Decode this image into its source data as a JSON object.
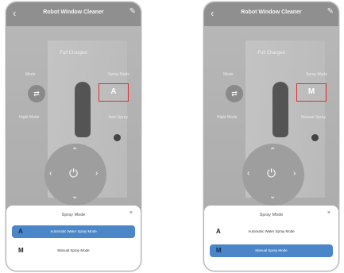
{
  "header": {
    "back_icon": "chevron-left-icon",
    "title": "Robot Window Cleaner",
    "edit_icon": "edit-icon"
  },
  "status": "Full Charged",
  "controls": {
    "mode_label": "Mode",
    "spray_mode_label": "Spray Mode",
    "night_mode_label": "Night Mode",
    "mode_icon": "swap-icon",
    "power_icon": "power-icon"
  },
  "screens": [
    {
      "spray_value": "A",
      "spray_type_label": "Auto Spray",
      "spray_type_icon": "spray-drop-icon",
      "sheet": {
        "title": "Spray Mode",
        "options": [
          {
            "letter": "A",
            "label": "Automatic Water Spray Mode",
            "selected": true
          },
          {
            "letter": "M",
            "label": "Manual Spray Mode",
            "selected": false
          }
        ]
      }
    },
    {
      "spray_value": "M",
      "spray_type_label": "Manual Spray",
      "spray_type_icon": "spray-drop-icon",
      "sheet": {
        "title": "Spray Mode",
        "options": [
          {
            "letter": "A",
            "label": "Automatic Water Spray Mode",
            "selected": false
          },
          {
            "letter": "M",
            "label": "Manual Spray Mode",
            "selected": true
          }
        ]
      }
    }
  ],
  "colors": {
    "selection": "#4b86c8",
    "highlight_border": "#e03030"
  }
}
